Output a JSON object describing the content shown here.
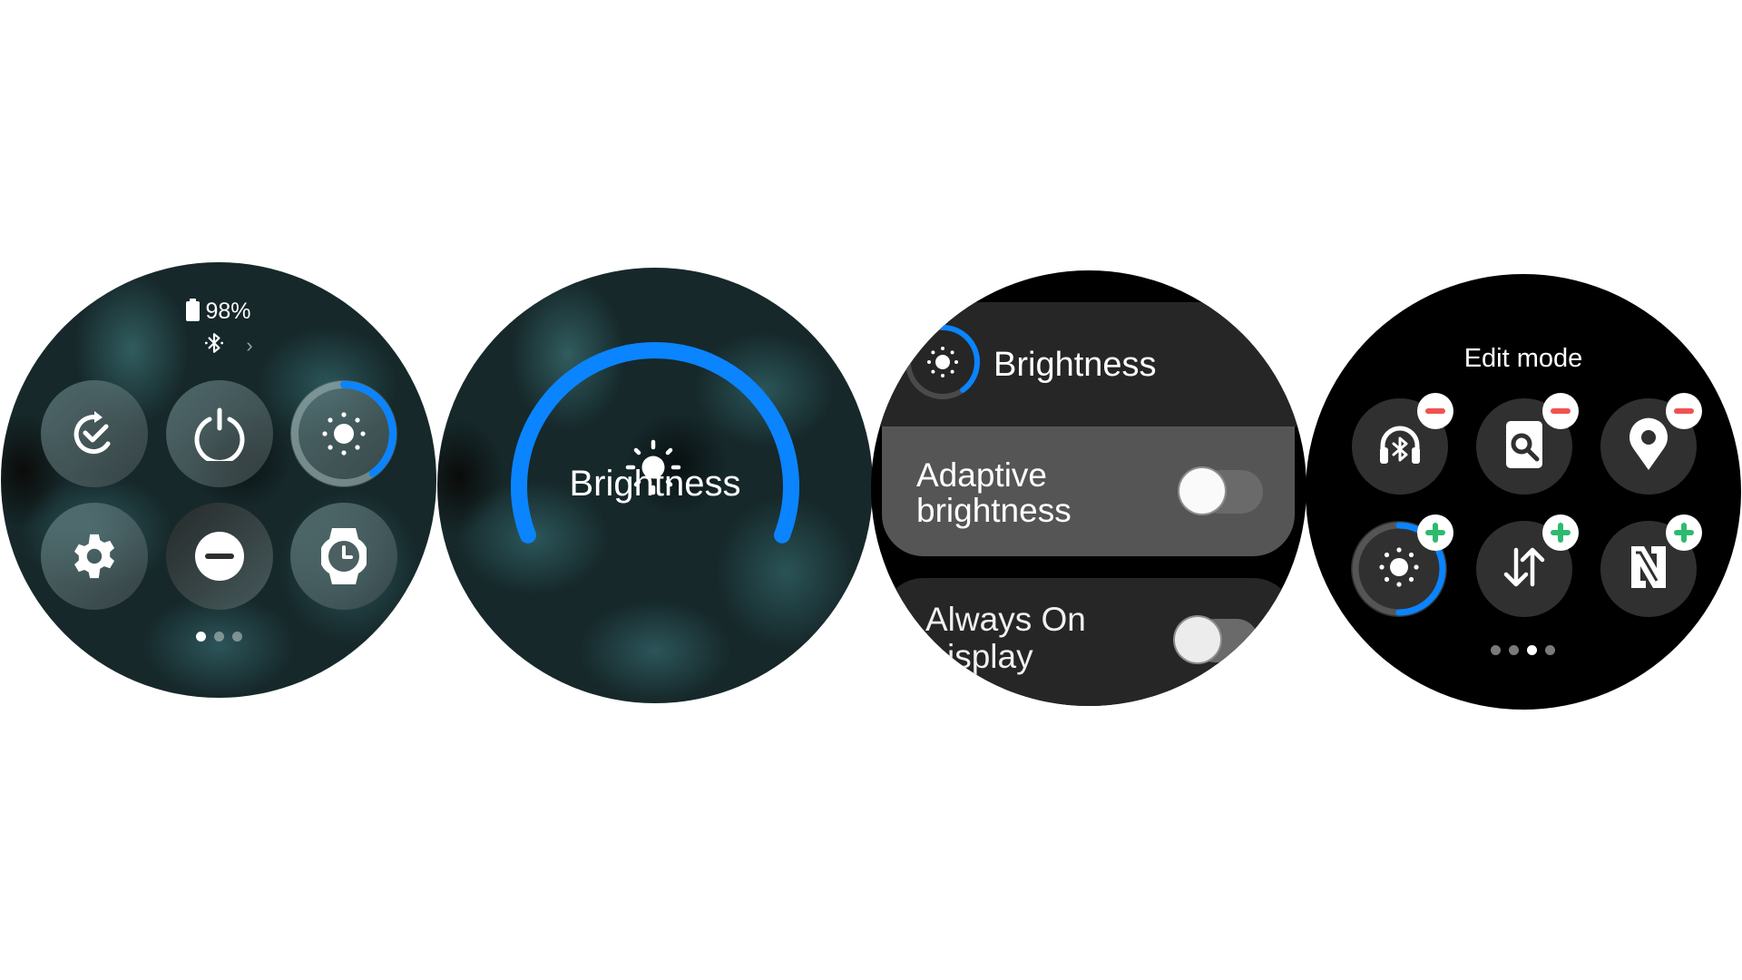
{
  "colors": {
    "accent_blue": "#0a84ff",
    "page_background": "#ffffff",
    "minus_badge": "#ef5350",
    "plus_badge": "#2dba6e"
  },
  "quick_panel": {
    "battery": {
      "icon": "battery-icon",
      "percent_label": "98%"
    },
    "connection": {
      "icon": "bluetooth-icon",
      "chevron": "chevron-right-icon",
      "chevron_glyph": "›"
    },
    "tiles": [
      {
        "id": "sync",
        "icon": "refresh-check-icon"
      },
      {
        "id": "power",
        "icon": "power-icon"
      },
      {
        "id": "brightness",
        "icon": "sun-icon",
        "level": 0.4
      },
      {
        "id": "settings",
        "icon": "gear-icon"
      },
      {
        "id": "do-not-disturb",
        "icon": "minus-circle-icon"
      },
      {
        "id": "watch-only",
        "icon": "watch-clock-icon"
      }
    ],
    "page_indicator": {
      "count": 3,
      "active_index": 0
    }
  },
  "brightness_dialog": {
    "label": "Brightness",
    "icon": "sun-icon",
    "level": 1.0
  },
  "display_settings": {
    "header": {
      "title": "Brightness",
      "icon": "sun-icon",
      "level": 0.4
    },
    "rows": [
      {
        "label_line1": "Adaptive",
        "label_line2": "brightness",
        "toggle_on": false
      },
      {
        "label_line1": "Always On",
        "label_line2": "isplay",
        "toggle_on": false
      }
    ]
  },
  "edit_mode": {
    "title": "Edit mode",
    "tiles": [
      {
        "id": "bluetooth-audio",
        "icon": "bluetooth-headphones-icon",
        "badge": "remove"
      },
      {
        "id": "find-my-phone",
        "icon": "find-phone-icon",
        "badge": "remove"
      },
      {
        "id": "location",
        "icon": "location-pin-icon",
        "badge": "remove"
      },
      {
        "id": "brightness",
        "icon": "sun-icon",
        "badge": "add",
        "level": 0.5
      },
      {
        "id": "mobile-data",
        "icon": "data-transfer-icon",
        "badge": "add"
      },
      {
        "id": "nfc",
        "icon": "nfc-icon",
        "badge": "add"
      }
    ],
    "page_indicator": {
      "count": 4,
      "active_index": 2
    }
  }
}
